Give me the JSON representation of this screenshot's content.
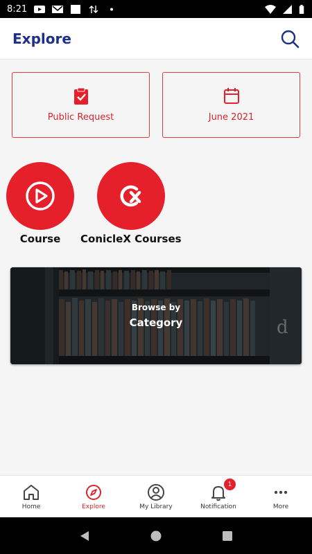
{
  "status_bar": {
    "time": "8:21"
  },
  "app_bar": {
    "title": "Explore"
  },
  "cards": [
    {
      "label": "Public Request",
      "icon": "clipboard-check-icon"
    },
    {
      "label": "June 2021",
      "icon": "calendar-icon"
    }
  ],
  "shortcuts": [
    {
      "label": "Course",
      "icon": "play-circle-icon"
    },
    {
      "label": "ConicleX Courses",
      "icon": "conicle-x-icon"
    }
  ],
  "banner": {
    "line1": "Browse by",
    "line2": "Category"
  },
  "bottom_nav": [
    {
      "label": "Home",
      "icon": "home-icon",
      "active": false
    },
    {
      "label": "Explore",
      "icon": "compass-icon",
      "active": true
    },
    {
      "label": "My Library",
      "icon": "user-circle-icon",
      "active": false
    },
    {
      "label": "Notification",
      "icon": "bell-icon",
      "active": false,
      "badge": "1"
    },
    {
      "label": "More",
      "icon": "more-icon",
      "active": false
    }
  ],
  "colors": {
    "primary_red": "#e5202b",
    "title_blue": "#1e2f86"
  }
}
